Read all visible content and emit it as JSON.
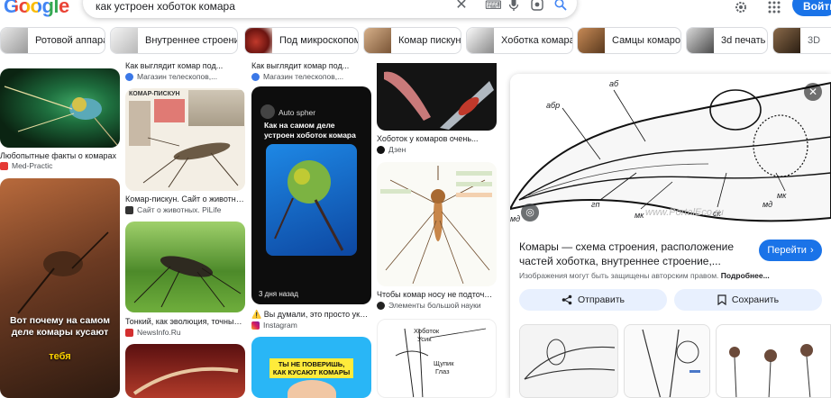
{
  "header": {
    "logo_text": "Google",
    "search_query": "как устроен хоботок комара",
    "signin_label": "Войти"
  },
  "chips": [
    {
      "label": "Ротовой аппарат"
    },
    {
      "label": "Внутреннее строение"
    },
    {
      "label": "Под микроскопом"
    },
    {
      "label": "Комар пискун"
    },
    {
      "label": "Хоботка комара"
    },
    {
      "label": "Самцы комаров"
    },
    {
      "label": "3d печать"
    }
  ],
  "results": {
    "col1": [
      {
        "caption": "Любопытные факты о комарах",
        "source": "Med-Practic"
      },
      {
        "overlay": "Вот почему на самом деле комары кусают",
        "overlay_accent": "тебя"
      }
    ],
    "col2": [
      {
        "caption": "Как выглядит комар под...",
        "source": "Магазин телескопов,..."
      },
      {
        "caption": "Комар-пискун. Сайт о животных...",
        "source": "Сайт о животных. PiLife",
        "image_label": "КОМАР-ПИСКУН"
      },
      {
        "caption": "Тонкий, как эволюция, точный,...",
        "source": "NewsInfo.Ru"
      }
    ],
    "col3": [
      {
        "caption": "Как выглядит комар под...",
        "source": "Магазин телескопов,..."
      },
      {
        "caption": "Вы думали, это просто укус?...",
        "source": "Instagram",
        "brand": "Auto spher",
        "headline": "Как на самом деле устроен хоботок комара",
        "age": "3 дня назад"
      },
      {
        "banner": "ТЫ НЕ ПОВЕРИШЬ, КАК КУСАЮТ КОМАРЫ"
      }
    ],
    "col4": [
      {
        "caption": "Хоботок у комаров очень...",
        "source": "Дзен"
      },
      {
        "caption": "Чтобы комар носу не подточил •...",
        "source": "Элементы большой науки"
      },
      {
        "labels": [
          "Хоботок",
          "Усик",
          "Щупик",
          "Глаз"
        ]
      }
    ]
  },
  "panel": {
    "diagram_labels": [
      "аб",
      "абр",
      "гп",
      "мк",
      "мд",
      "ск",
      "мк",
      "мд"
    ],
    "watermark": "www.PortalEco.ru",
    "title": "Комары — схема строения, расположение частей хоботка, внутреннее строение,...",
    "visit_label": "Перейти",
    "notice": "Изображения могут быть защищены авторским правом.",
    "notice_more": "Подробнее...",
    "share_label": "Отправить",
    "save_label": "Сохранить"
  },
  "colors": {
    "accent": "#1a73e8",
    "chip_border": "#dadce0",
    "button_bg": "#e8f0fe"
  }
}
